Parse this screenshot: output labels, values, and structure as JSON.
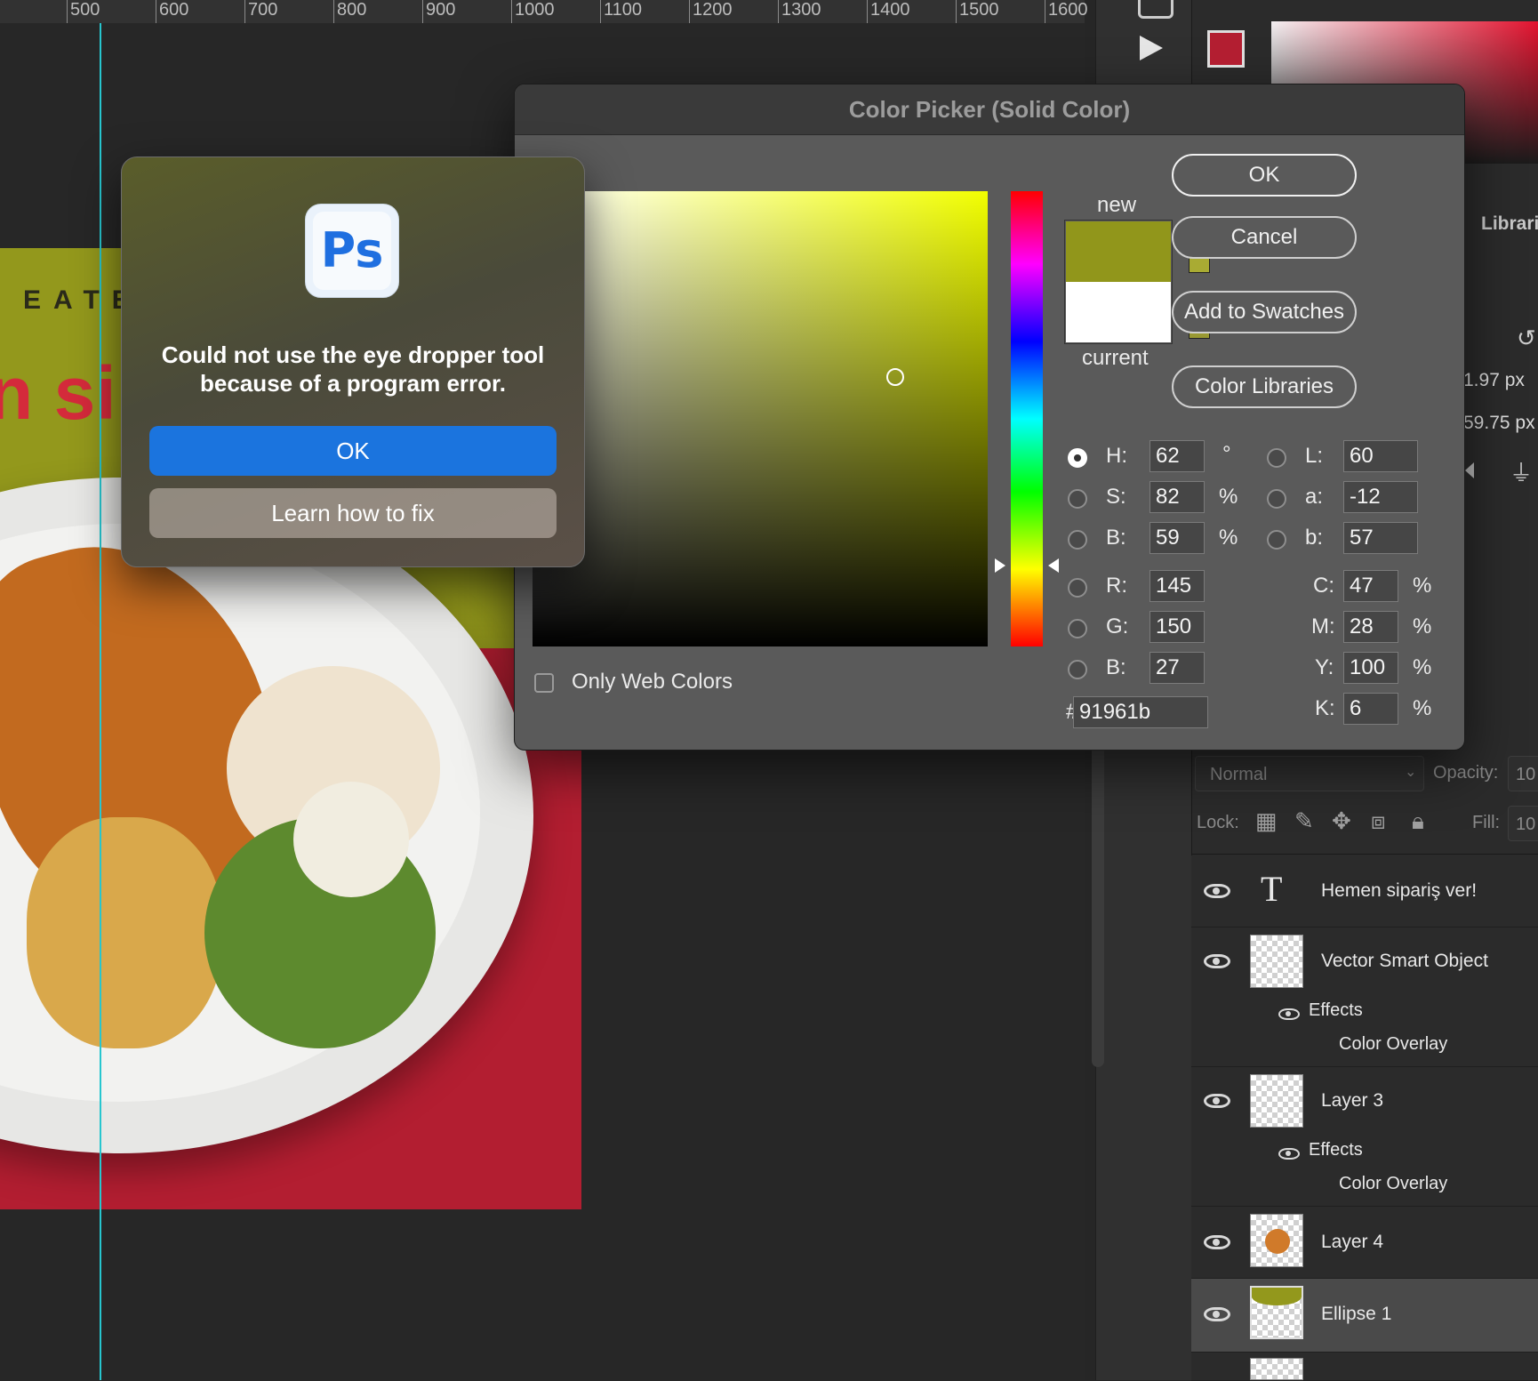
{
  "ruler": {
    "ticks": [
      "500",
      "600",
      "700",
      "800",
      "900",
      "1000",
      "1100",
      "1200",
      "1300",
      "1400",
      "1500",
      "1600"
    ]
  },
  "poster": {
    "brand_text": "EATE",
    "cta_text": "n sip"
  },
  "alert": {
    "message": "Could not use the eye dropper tool because of a program error.",
    "ok_label": "OK",
    "learn_label": "Learn how to fix",
    "logo_text": "Ps"
  },
  "picker": {
    "title": "Color Picker (Solid Color)",
    "new_label": "new",
    "current_label": "current",
    "new_color": "#91961b",
    "current_color": "#ffffff",
    "buttons": {
      "ok": "OK",
      "cancel": "Cancel",
      "add_swatches": "Add to Swatches",
      "color_libraries": "Color Libraries"
    },
    "only_web_colors": "Only Web Colors",
    "fields": {
      "h": {
        "label": "H:",
        "value": "62",
        "unit": "°"
      },
      "s": {
        "label": "S:",
        "value": "82",
        "unit": "%"
      },
      "b": {
        "label": "B:",
        "value": "59",
        "unit": "%"
      },
      "r": {
        "label": "R:",
        "value": "145"
      },
      "g": {
        "label": "G:",
        "value": "150"
      },
      "bl": {
        "label": "B:",
        "value": "27"
      },
      "l": {
        "label": "L:",
        "value": "60"
      },
      "a": {
        "label": "a:",
        "value": "-12"
      },
      "lab_b": {
        "label": "b:",
        "value": "57"
      },
      "c": {
        "label": "C:",
        "value": "47",
        "unit": "%"
      },
      "m": {
        "label": "M:",
        "value": "28",
        "unit": "%"
      },
      "y": {
        "label": "Y:",
        "value": "100",
        "unit": "%"
      },
      "k": {
        "label": "K:",
        "value": "6",
        "unit": "%"
      }
    },
    "hex_symbol": "#",
    "hex_value": "91961b"
  },
  "right_panel": {
    "libraries_tab": "Librari",
    "value1": "1.97 px",
    "value2": "59.75 px"
  },
  "layers_panel": {
    "blend_mode": "Normal",
    "opacity_label": "Opacity:",
    "opacity_value": "10",
    "lock_label": "Lock:",
    "fill_label": "Fill:",
    "fill_value": "10",
    "layers": [
      {
        "name": "Hemen sipariş ver!"
      },
      {
        "name": "Vector Smart Object",
        "effects": "Effects",
        "overlay": "Color Overlay"
      },
      {
        "name": "Layer 3",
        "effects": "Effects",
        "overlay": "Color Overlay"
      },
      {
        "name": "Layer 4"
      },
      {
        "name": "Ellipse 1"
      }
    ]
  }
}
